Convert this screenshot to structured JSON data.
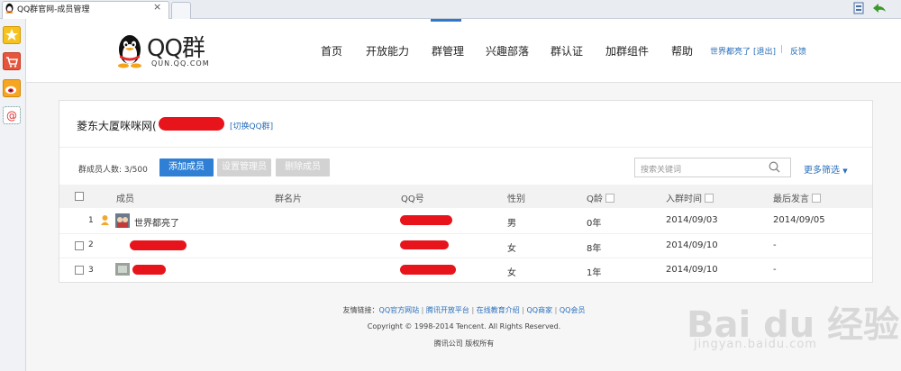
{
  "browser": {
    "tab_title": "QQ群官网-成员管理",
    "close_glyph": "×"
  },
  "header": {
    "logo_text": "QQ群",
    "logo_sub": "QUN.QQ.COM",
    "nav": [
      "首页",
      "开放能力",
      "群管理",
      "兴趣部落",
      "群认证",
      "加群组件",
      "帮助"
    ],
    "active_nav": "群管理",
    "user_name": "世界都亮了",
    "logout_label": "[退出]",
    "divider": "|",
    "feedback_label": "反馈",
    "accent_color": "#2e78c7"
  },
  "group": {
    "name": "菱东大厦咪咪网(",
    "switch_label": "[切换QQ群]"
  },
  "toolbar": {
    "member_count_label": "群成员人数: 3/500",
    "add_member": "添加成员",
    "set_admin": "设置管理员",
    "delete_member": "删除成员",
    "search_placeholder": "搜索关键词",
    "more_filter": "更多筛选",
    "more_filter_caret": "▼"
  },
  "table": {
    "columns": [
      "成员",
      "群名片",
      "QQ号",
      "性别",
      "Q龄",
      "入群时间",
      "最后发言"
    ],
    "rows": [
      {
        "index": "1",
        "name": "世界都亮了",
        "gender": "男",
        "qage": "0年",
        "join": "2014/09/03",
        "last": "2014/09/05"
      },
      {
        "index": "2",
        "name": "",
        "gender": "女",
        "qage": "8年",
        "join": "2014/09/10",
        "last": "-"
      },
      {
        "index": "3",
        "name": "",
        "gender": "女",
        "qage": "1年",
        "join": "2014/09/10",
        "last": "-"
      }
    ]
  },
  "footer": {
    "links_prefix": "友情链接：",
    "links": [
      "QQ官方网站",
      "腾讯开放平台",
      "在线教育介绍",
      "QQ商家",
      "QQ会员"
    ],
    "link_sep": " | ",
    "copyright": "Copyright © 1998-2014 Tencent. All Rights Reserved.",
    "corp": "腾讯公司 版权所有"
  },
  "watermark": {
    "logo": "Bai du 经验",
    "url": "jingyan.baidu.com"
  }
}
